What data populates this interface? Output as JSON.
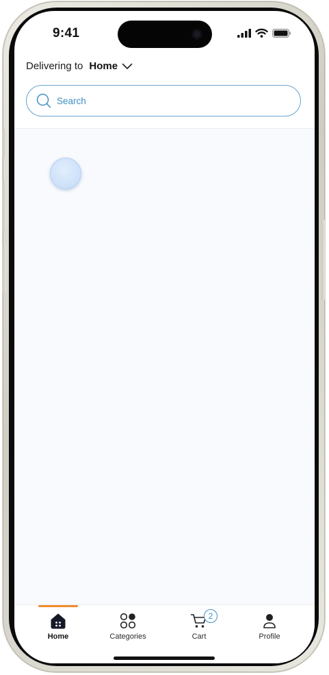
{
  "status_bar": {
    "time": "9:41"
  },
  "header": {
    "delivery_prefix": "Delivering to",
    "delivery_location": "Home"
  },
  "search": {
    "placeholder": "Search"
  },
  "tabs": [
    {
      "label": "Home",
      "icon": "home-icon",
      "active": true
    },
    {
      "label": "Categories",
      "icon": "grid-icon",
      "active": false
    },
    {
      "label": "Cart",
      "icon": "cart-icon",
      "active": false,
      "badge": "2"
    },
    {
      "label": "Profile",
      "icon": "user-icon",
      "active": false
    }
  ],
  "colors": {
    "accent": "#3f8fc2",
    "active_indicator": "#f08a2c",
    "content_background": "#f8fafd"
  }
}
